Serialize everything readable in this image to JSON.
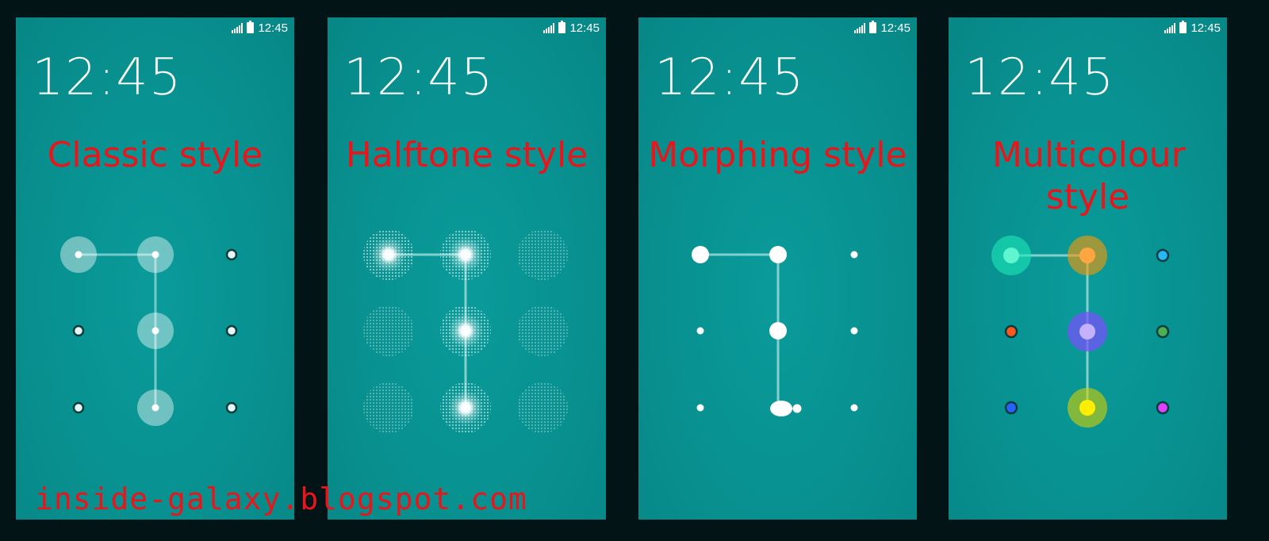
{
  "status_time": "12:45",
  "lock_time": "12:45",
  "screens": [
    {
      "style_label": "Classic style"
    },
    {
      "style_label": "Halftone style"
    },
    {
      "style_label": "Morphing style"
    },
    {
      "style_label": "Multicolour style"
    }
  ],
  "watermark": "inside-galaxy.blogspot.com",
  "colors": {
    "screen_background": "#089190",
    "label_red": "#e8161a",
    "multicolour_dots": [
      "#1de9b6",
      "#ff9800",
      "#29b6f6",
      "#ff5722",
      "#7c4dff",
      "#4caf50",
      "#2962ff",
      "#ffeb3b",
      "#e040fb"
    ]
  }
}
